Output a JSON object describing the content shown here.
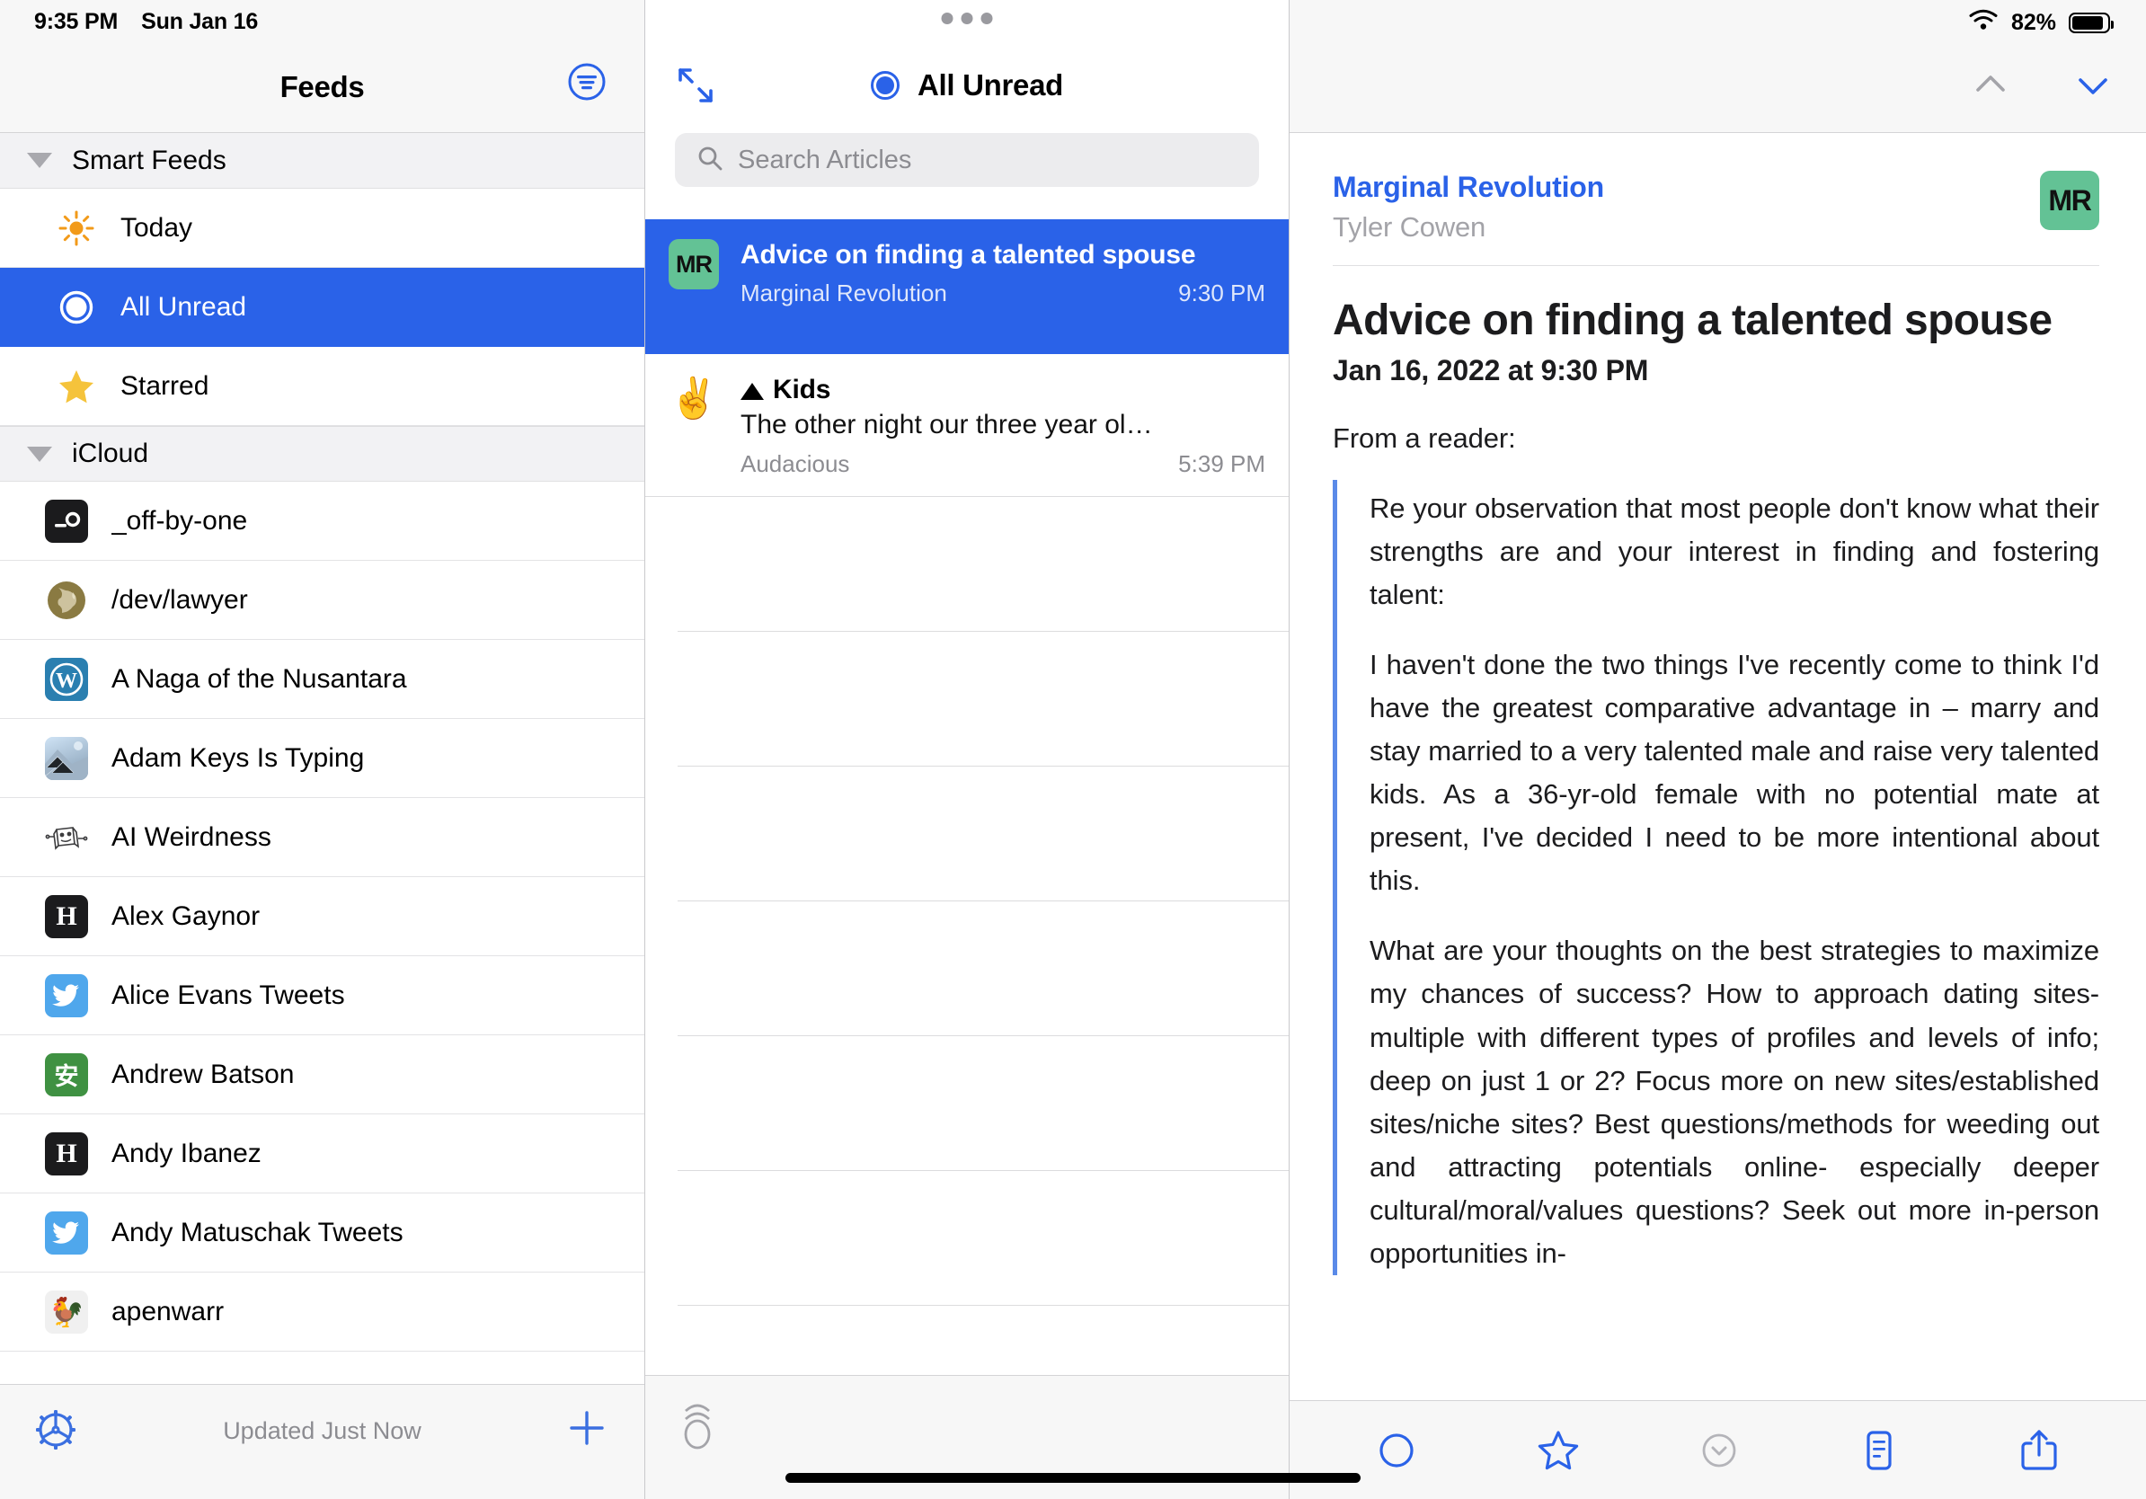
{
  "status_bar": {
    "time": "9:35 PM",
    "date": "Sun Jan 16",
    "battery_percent": "82%",
    "wifi_icon": "wifi-icon",
    "battery_icon": "battery-icon"
  },
  "sidebar": {
    "title": "Feeds",
    "filter_icon": "filter-icon",
    "groups": [
      {
        "name": "Smart Feeds",
        "disclosure_icon": "triangle-down-icon",
        "items": [
          {
            "label": "Today",
            "icon": "sun-icon",
            "selected": false
          },
          {
            "label": "All Unread",
            "icon": "unread-circle-icon",
            "selected": true
          },
          {
            "label": "Starred",
            "icon": "star-icon",
            "selected": false
          }
        ]
      },
      {
        "name": "iCloud",
        "disclosure_icon": "triangle-down-icon",
        "items": [
          {
            "label": "_off-by-one",
            "icon": "terminal-favicon"
          },
          {
            "label": "/dev/lawyer",
            "icon": "globe-favicon"
          },
          {
            "label": "A Naga of the Nusantara",
            "icon": "wordpress-favicon"
          },
          {
            "label": "Adam Keys Is Typing",
            "icon": "photo-favicon"
          },
          {
            "label": "AI Weirdness",
            "icon": "robot-favicon"
          },
          {
            "label": "Alex Gaynor",
            "icon": "h-letter-favicon"
          },
          {
            "label": "Alice Evans Tweets",
            "icon": "twitter-favicon"
          },
          {
            "label": "Andrew Batson",
            "icon": "chinese-char-favicon"
          },
          {
            "label": "Andy Ibanez",
            "icon": "h-letter-favicon"
          },
          {
            "label": "Andy Matuschak Tweets",
            "icon": "twitter-favicon"
          },
          {
            "label": "apenwarr",
            "icon": "chicken-favicon"
          }
        ]
      }
    ],
    "toolbar": {
      "settings_icon": "gear-icon",
      "status_text": "Updated Just Now",
      "add_icon": "plus-icon"
    }
  },
  "article_list": {
    "title": "All Unread",
    "title_icon": "unread-circle-icon",
    "expand_icon": "expand-arrows-icon",
    "multitask_handle_icon": "multitask-dots-icon",
    "search": {
      "placeholder": "Search Articles",
      "value": "",
      "icon": "search-icon"
    },
    "items": [
      {
        "title": "Advice on finding a talented spouse",
        "summary": "",
        "feed": "Marginal Revolution",
        "time": "9:30 PM",
        "icon": "mr-favicon",
        "icon_text": "MR",
        "selected": true,
        "has_triangle": false
      },
      {
        "title": "Kids",
        "summary": "The other night our three year ol…",
        "feed": "Audacious",
        "time": "5:39 PM",
        "icon": "peace-hand-favicon",
        "icon_text": "✌️",
        "selected": false,
        "has_triangle": true
      }
    ],
    "empty_row_count": 7,
    "toolbar": {
      "mark_all_read_icon": "mark-all-read-icon"
    }
  },
  "detail": {
    "nav": {
      "prev_icon": "chevron-up-icon",
      "next_icon": "chevron-down-icon"
    },
    "feed_name": "Marginal Revolution",
    "author": "Tyler Cowen",
    "avatar_text": "MR",
    "title": "Advice on finding a talented spouse",
    "date": "Jan 16, 2022 at 9:30 PM",
    "intro": "From a reader:",
    "quote_paragraphs": [
      "Re your observation that most people don't know what their strengths are and your interest in finding and fostering talent:",
      "I haven't done the two things I've recently come to think I'd have the greatest comparative advantage in – marry and stay married to a very talented male and raise very talented kids. As a 36-yr-old female with no potential mate at present, I've decided I need to be more intentional about this.",
      "What are your thoughts on the best strategies to maximize my chances of success? How to approach dating sites- multiple with different types of profiles and levels of info; deep on just 1 or 2? Focus more on new sites/established sites/niche sites? Best questions/methods for weeding out and attracting potentials online- especially deeper cultural/moral/values questions? Seek out more in-person opportunities in-"
    ],
    "toolbar": [
      {
        "icon": "mark-unread-circle-icon",
        "state": "enabled"
      },
      {
        "icon": "star-outline-icon",
        "state": "enabled"
      },
      {
        "icon": "chevron-down-circle-icon",
        "state": "disabled"
      },
      {
        "icon": "reader-view-icon",
        "state": "enabled"
      },
      {
        "icon": "share-icon",
        "state": "enabled"
      }
    ]
  },
  "colors": {
    "accent_blue": "#2a62e8",
    "selection_blue": "#2a62e8",
    "mr_green": "#63c295",
    "quote_bar": "#5a8ae8",
    "secondary_text": "#8c8c91"
  }
}
